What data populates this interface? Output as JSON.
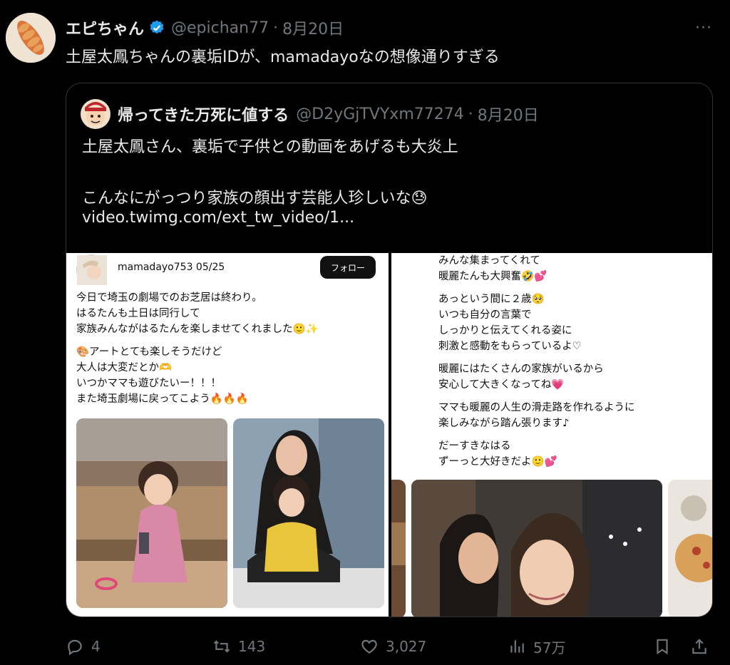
{
  "tweet": {
    "author_name": "エピちゃん",
    "handle": "@epichan77",
    "separator": "·",
    "date": "8月20日",
    "more_label": "···",
    "text": "土屋太鳳ちゃんの裏垢IDが、mamadayoなの想像通りすぎる"
  },
  "quote": {
    "author_name": "帰ってきた万死に値する",
    "handle": "@D2yGjTVYxm77274",
    "separator": "·",
    "date": "8月20日",
    "line1": "土屋太鳳さん、裏垢で子供との動画をあげるも大炎上",
    "line2": "こんなにがっつり家族の顔出す芸能人珍しいな😓",
    "link": "video.twimg.com/ext_tw_video/1..."
  },
  "ig_left": {
    "user": "mamadayo753 05/25",
    "follow": "フォロー",
    "lines": [
      "今日で埼玉の劇場でのお芝居は終わり。",
      "はるたんも土日は同行して",
      "家族みんながはるたんを楽しませてくれました🙂✨",
      "",
      "🎨アートとても楽しそうだけど",
      "大人は大変だとか🫶",
      "いつかママも遊びたいー！！！",
      "また埼玉劇場に戻ってこよう🔥🔥🔥"
    ]
  },
  "ig_right": {
    "lines": [
      "みんな集まってくれて",
      "暖麗たんも大興奮🤣💕",
      "",
      "あっという間に２歳🥺",
      "いつも自分の言葉で",
      "しっかりと伝えてくれる姿に",
      "刺激と感動をもらっているよ♡",
      "",
      "暖麗にはたくさんの家族がいるから",
      "安心して大きくなってね💗",
      "",
      "ママも暖麗の人生の滑走路を作れるように",
      "楽しみながら踏ん張ります♪",
      "",
      "だーすきなはる",
      "ずーっと大好きだよ🙂💕"
    ]
  },
  "actions": {
    "replies": "4",
    "retweets": "143",
    "likes": "3,027",
    "views": "57万"
  },
  "colors": {
    "background": "#000000",
    "text": "#e7e9ea",
    "muted": "#71767b",
    "border": "#2f3336",
    "verified": "#1d9bf0"
  }
}
